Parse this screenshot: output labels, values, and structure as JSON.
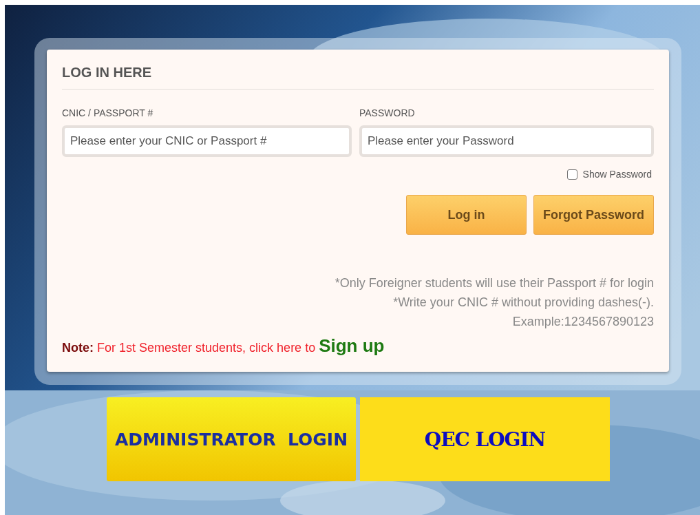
{
  "login_panel": {
    "title": "LOG IN HERE",
    "fields": [
      {
        "label": "CNIC / PASSPORT #",
        "placeholder": "Please enter your CNIC or Passport #"
      },
      {
        "label": "PASSWORD",
        "placeholder": "Please enter your Password"
      }
    ],
    "show_password": {
      "label": "Show Password",
      "checked": false
    },
    "buttons": [
      "Log in",
      "Forgot Password"
    ],
    "hints": [
      "*Only Foreigner students will use their Passport # for login",
      "*Write your CNIC # without providing dashes(-).",
      "Example:1234567890123"
    ],
    "note": {
      "label": "Note:",
      "text": "For 1st Semester students, click here to",
      "link": "Sign up"
    }
  },
  "portal_buttons": [
    {
      "label": "ADMINISTRATOR  LOGIN",
      "kind": "gradient"
    },
    {
      "label": "QEC LOGIN",
      "kind": "flat"
    }
  ]
}
